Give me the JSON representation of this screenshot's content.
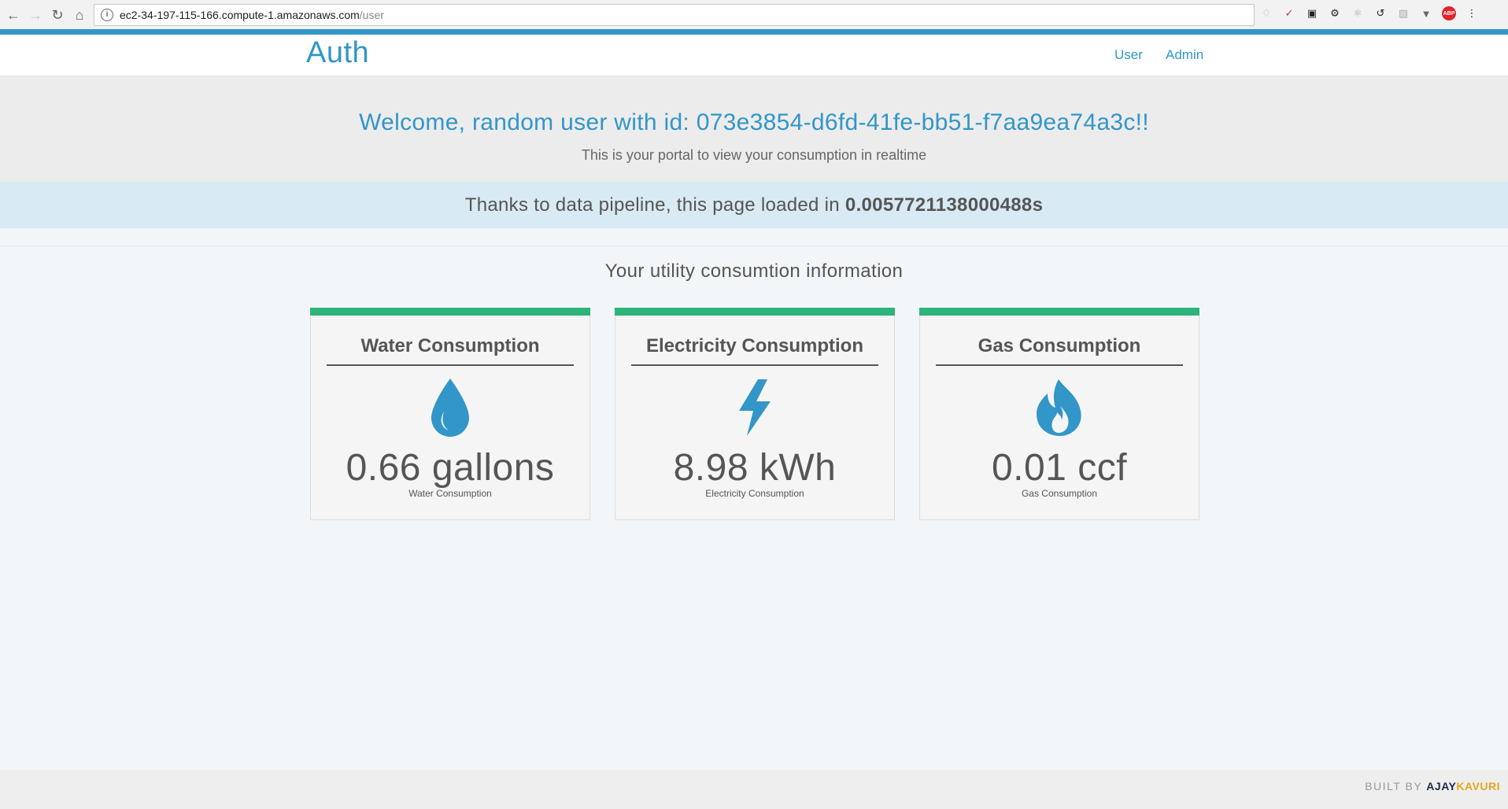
{
  "browser": {
    "url_host": "ec2-34-197-115-166.compute-1.amazonaws.com",
    "url_path": "/user",
    "info_glyph": "i"
  },
  "header": {
    "brand": "Auth",
    "nav": [
      {
        "label": "User"
      },
      {
        "label": "Admin"
      }
    ]
  },
  "welcome": {
    "title": "Welcome, random user with id: 073e3854-d6fd-41fe-bb51-f7aa9ea74a3c!!",
    "subtitle": "This is your portal to view your consumption in realtime"
  },
  "pipeline": {
    "prefix": "Thanks to data pipeline, this page loaded in ",
    "time": "0.0057721138000488s"
  },
  "section_title": "Your utility consumtion information",
  "cards": [
    {
      "title": "Water Consumption",
      "value": "0.66 gallons",
      "label": "Water Consumption",
      "icon": "water-drop-icon"
    },
    {
      "title": "Electricity Consumption",
      "value": "8.98 kWh",
      "label": "Electricity Consumption",
      "icon": "lightning-bolt-icon"
    },
    {
      "title": "Gas Consumption",
      "value": "0.01 ccf",
      "label": "Gas Consumption",
      "icon": "flame-icon"
    }
  ],
  "footer": {
    "built_by": "BUILT BY ",
    "name_first": "AJAY",
    "name_last": "KAVURI"
  },
  "colors": {
    "accent": "#3296c9",
    "card_accent": "#2db47a",
    "footer_first": "#1f2a4d",
    "footer_last": "#e4a61d"
  }
}
